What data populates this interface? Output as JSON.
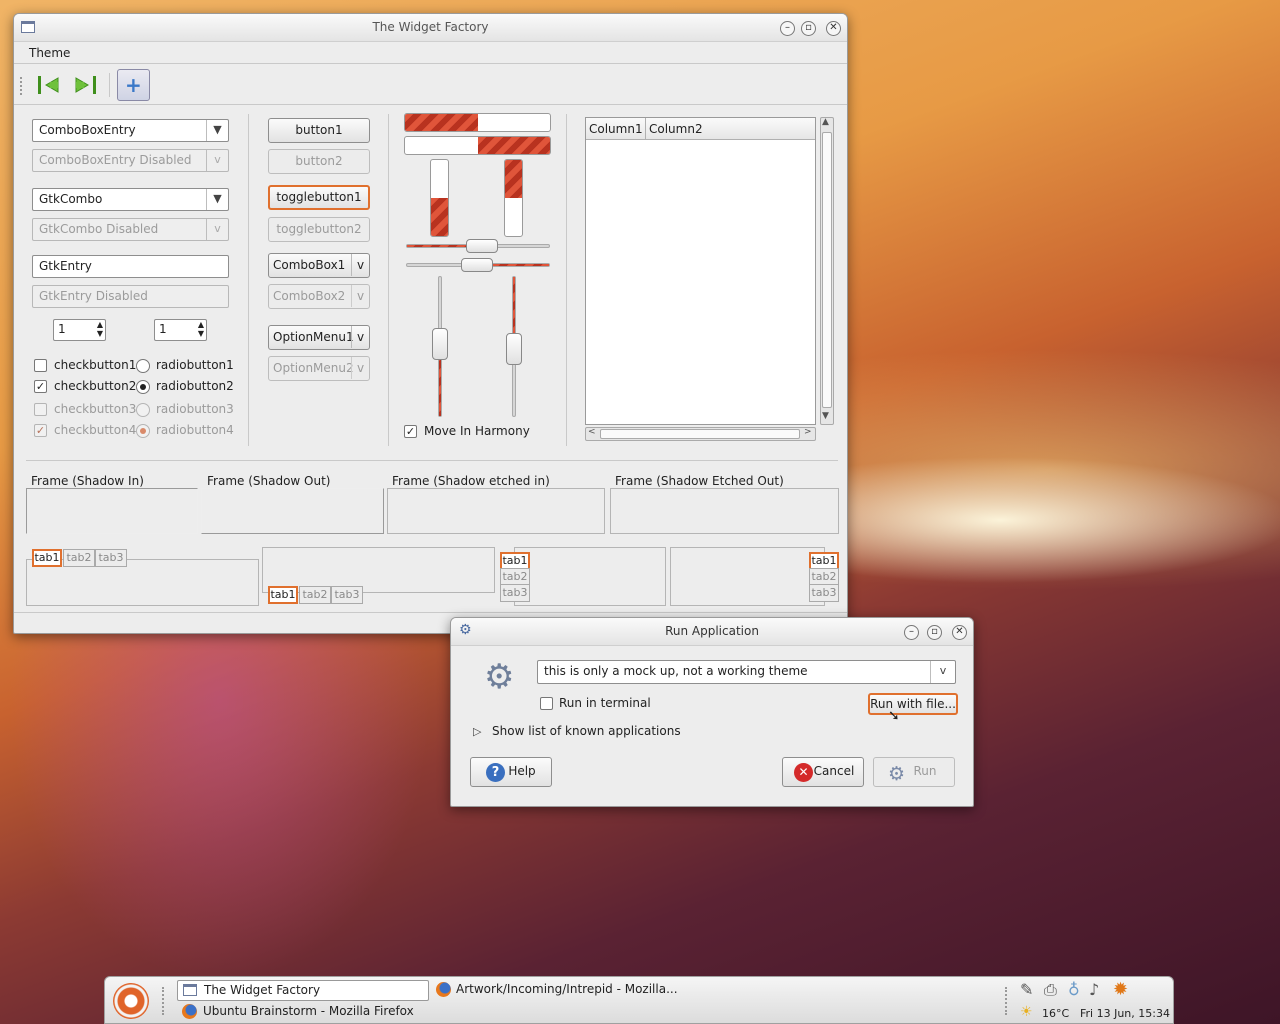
{
  "factory": {
    "title": "The Widget Factory",
    "menu": [
      "Theme"
    ],
    "col1": {
      "combo_entry": "ComboBoxEntry",
      "combo_entry_disabled": "ComboBoxEntry Disabled",
      "gtkcombo": "GtkCombo",
      "gtkcombo_disabled": "GtkCombo Disabled",
      "gtkentry": "GtkEntry",
      "gtkentry_disabled": "GtkEntry Disabled",
      "spin1": "1",
      "spin2": "1",
      "check1": "checkbutton1",
      "check2": "checkbutton2",
      "check3": "checkbutton3",
      "check4": "checkbutton4",
      "radio1": "radiobutton1",
      "radio2": "radiobutton2",
      "radio3": "radiobutton3",
      "radio4": "radiobutton4"
    },
    "col2": {
      "button1": "button1",
      "button2": "button2",
      "toggle1": "togglebutton1",
      "toggle2": "togglebutton2",
      "combobox1": "ComboBox1",
      "combobox2": "ComboBox2",
      "option1": "OptionMenu1",
      "option2": "OptionMenu2"
    },
    "col3": {
      "harmony": "Move In Harmony",
      "progress_h1": 0.5,
      "progress_h2": 0.5,
      "progress_v1": 0.5,
      "progress_v2": 0.5
    },
    "tree": {
      "col1": "Column1",
      "col2": "Column2"
    },
    "frames": [
      "Frame (Shadow In)",
      "Frame (Shadow Out)",
      "Frame (Shadow etched in)",
      "Frame (Shadow Etched Out)"
    ],
    "tabs": [
      "tab1",
      "tab2",
      "tab3"
    ]
  },
  "run_dialog": {
    "title": "Run Application",
    "command": "this is only a mock up, not a working theme",
    "run_in_terminal": "Run in terminal",
    "run_with_file": "Run with file...",
    "show_list": "Show list of known applications",
    "help": "Help",
    "cancel": "Cancel",
    "run": "Run"
  },
  "panel": {
    "task1": "The Widget Factory",
    "task2": "Artwork/Incoming/Intrepid - Mozilla...",
    "task3": "Ubuntu Brainstorm - Mozilla Firefox",
    "temperature": "16°C",
    "clock": "Fri 13 Jun, 15:34"
  }
}
